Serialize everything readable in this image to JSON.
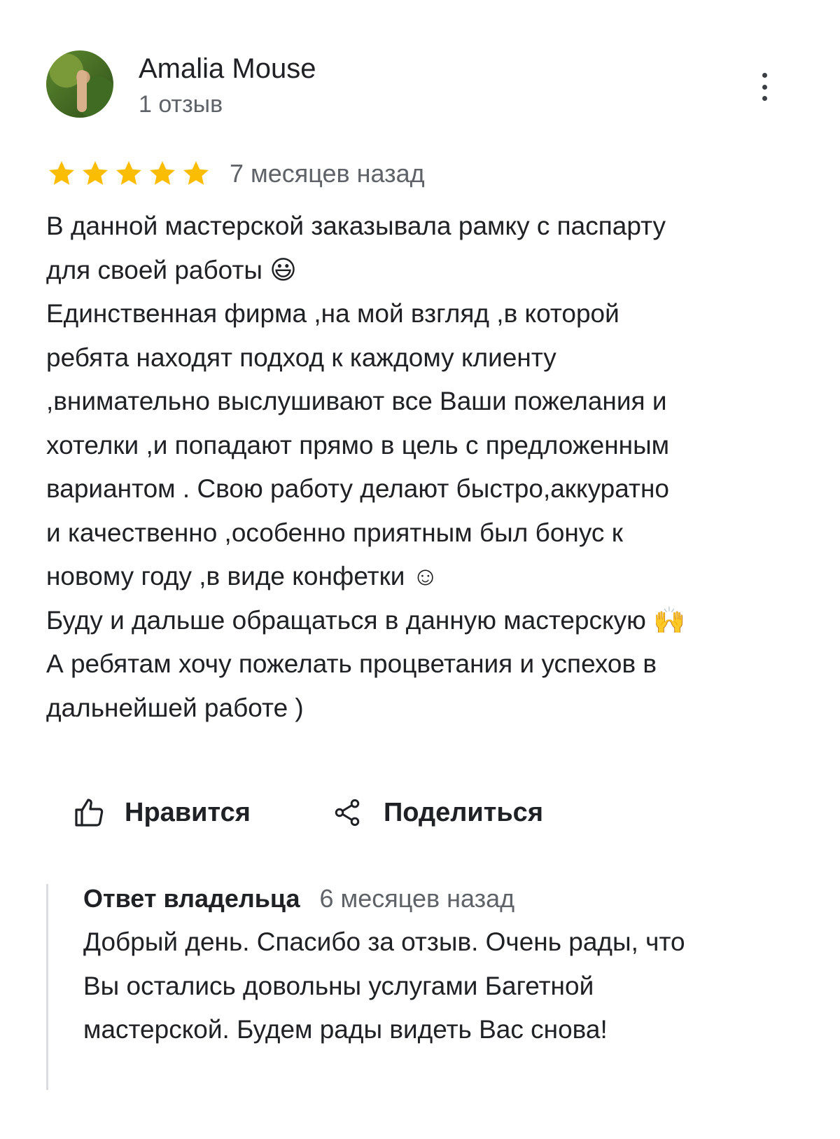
{
  "review": {
    "author": {
      "name": "Amalia Mouse",
      "meta": "1 отзыв"
    },
    "rating": 5,
    "date": "7 месяцев назад",
    "lines": [
      "В данной мастерской заказывала рамку с паспарту",
      "для своей работы 😃",
      "Единственная фирма ,на мой взгляд ,в которой",
      "ребята находят подход к каждому клиенту",
      ",внимательно выслушивают все Ваши пожелания и",
      "хотелки ,и попадают прямо в цель с предложенным",
      "вариантом . Свою работу делают быстро,аккуратно",
      "и качественно ,особенно приятным был бонус к",
      "новому году ,в виде конфетки ☺",
      "Буду и дальше обращаться в данную мастерскую 🙌",
      "А ребятам хочу пожелать процветания и успехов в",
      "дальнейшей работе )"
    ],
    "actions": {
      "like_label": "Нравится",
      "share_label": "Поделиться"
    },
    "icons": {
      "more": "more-vert-icon",
      "star": "star-icon",
      "like": "thumb-up-icon",
      "share": "share-icon"
    },
    "colors": {
      "star": "#fbbc04",
      "text": "#202124",
      "secondary": "#5f6368",
      "reply_border": "#dadce0"
    }
  },
  "owner_reply": {
    "title": "Ответ владельца",
    "date": "6 месяцев назад",
    "lines": [
      "Добрый день. Спасибо за отзыв. Очень рады, что",
      "Вы остались довольны услугами Багетной",
      "мастерской. Будем рады видеть Вас снова!"
    ]
  }
}
